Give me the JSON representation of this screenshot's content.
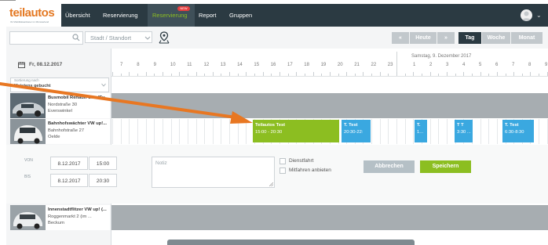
{
  "nav": {
    "logo": "teilautos",
    "logo_sub": "Ihr Mobilitätsanbieter im Münsterland",
    "items": [
      "Übersicht",
      "Reservierung",
      "Reservierung",
      "Report",
      "Gruppen"
    ],
    "badge": "NEW",
    "accent_color": "#8cbe21"
  },
  "filter": {
    "search_placeholder": "",
    "site_select": "Stadt / Standort",
    "prev": "«",
    "today": "Heute",
    "next": "»",
    "view_day": "Tag",
    "view_week": "Woche",
    "view_month": "Monat"
  },
  "left": {
    "date_header": "Fr, 08.12.2017",
    "sort_label": "Sortierung nach",
    "sort_value": "Meistens gebucht"
  },
  "cars": [
    {
      "title": "Busmobil Renault Clio (Ev...",
      "street": "Nordstraße 30",
      "city": "Everswinkel"
    },
    {
      "title": "Bahnhofswächter VW up!...",
      "street": "Bahnhofstraße 27",
      "city": "Oelde"
    },
    {
      "title": "Innenstadtflitzer VW up! (...",
      "street": "Roggenmarkt 2 (im ...",
      "city": "Beckum"
    }
  ],
  "timeline": {
    "hours": [
      "7",
      "8",
      "9",
      "10",
      "11",
      "12",
      "13",
      "14",
      "15",
      "16",
      "17",
      "18",
      "19",
      "20",
      "21",
      "22",
      "23"
    ],
    "day2_label": "Samstag, 9. Dezember 2017",
    "day2_hours": [
      "1",
      "2",
      "3",
      "4",
      "5",
      "6",
      "7",
      "8",
      "9"
    ]
  },
  "bookings": [
    {
      "title": "Teilautos Test",
      "time": "15:00 - 20:30",
      "color": "#8cbe21"
    },
    {
      "title": "T. Test",
      "time": "20:30-22:",
      "color": "#3aa8e0"
    },
    {
      "title": "T.",
      "time": "1...",
      "color": "#3aa8e0"
    },
    {
      "title": "T T",
      "time": "3:30 ...",
      "color": "#3aa8e0"
    },
    {
      "title": "T. Test",
      "time": "6:30-8:30",
      "color": "#3aa8e0"
    }
  ],
  "form": {
    "von_label": "VON",
    "bis_label": "BIS",
    "von_date": "8.12.2017",
    "von_time": "15:00",
    "bis_date": "8.12.2017",
    "bis_time": "20:30",
    "note_placeholder": "Notiz",
    "dienstfahrt": "Dienstfahrt",
    "mitfahren": "Mitfahren anbieten",
    "cancel": "Abbrechen",
    "save": "Speichern"
  }
}
